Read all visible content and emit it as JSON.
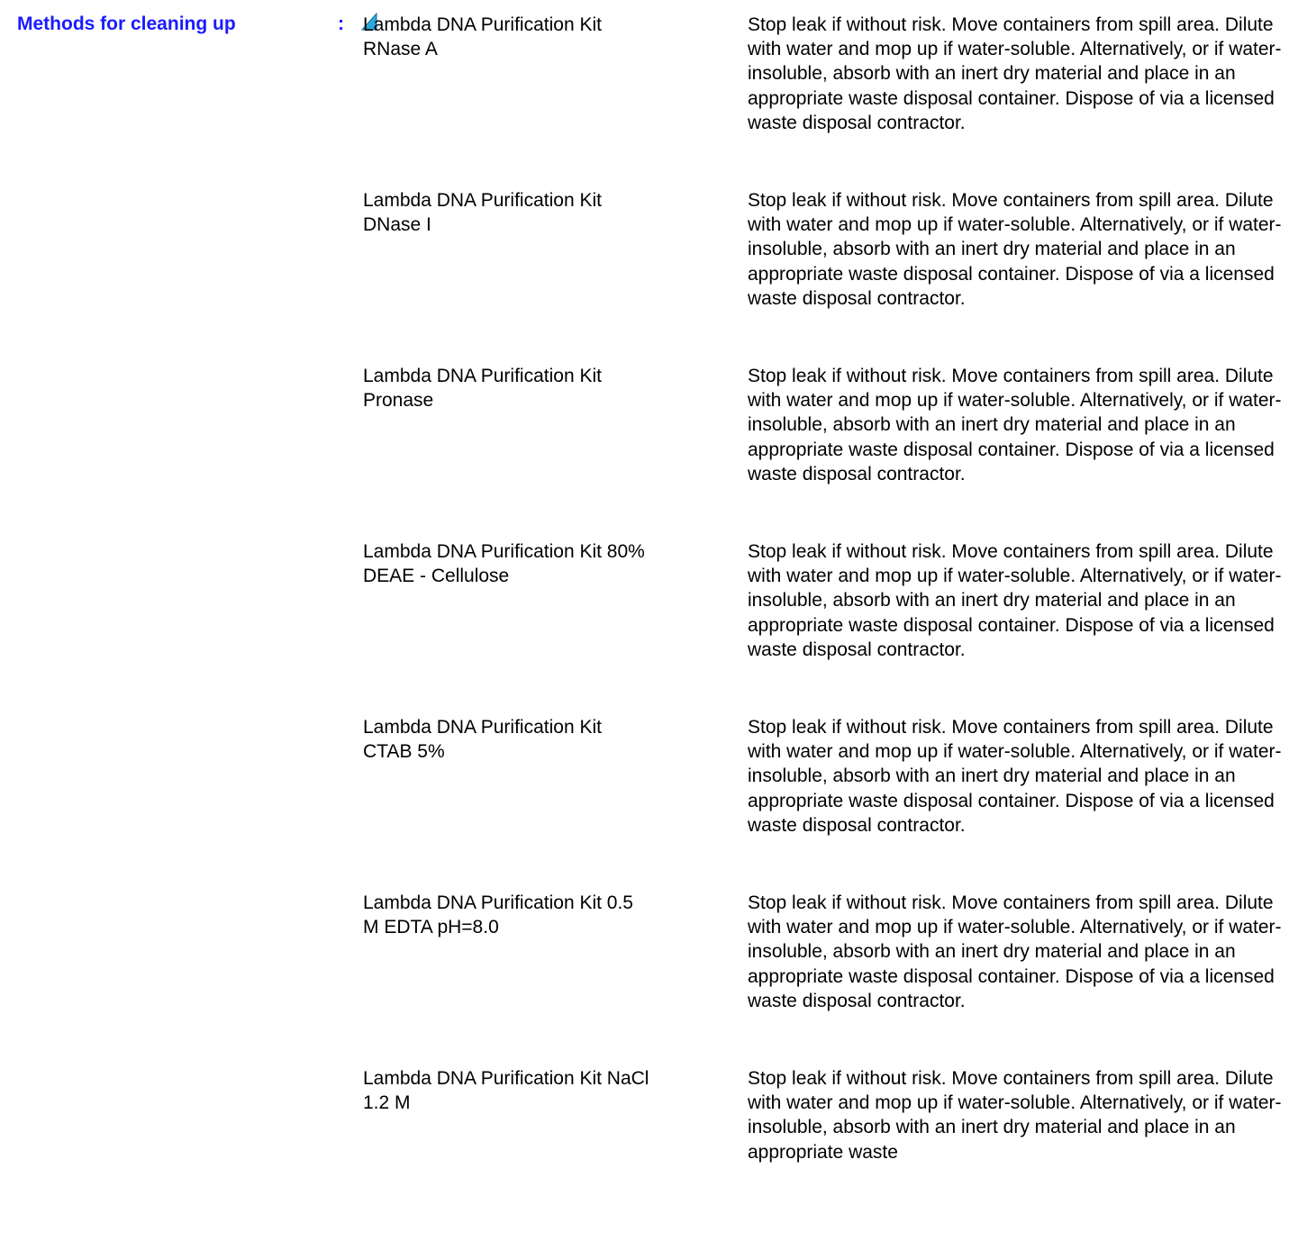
{
  "section": {
    "label": "Methods for cleaning up",
    "colon": ":"
  },
  "colors": {
    "label": "#1a1aff",
    "marker": "#2aa8e0"
  },
  "rows": [
    {
      "product_line1": "Lambda DNA Purification Kit",
      "product_line2": "RNase A",
      "description": "Stop leak if without risk.  Move containers from spill area.  Dilute with water and mop up if water-soluble. Alternatively, or if water-insoluble, absorb with an inert dry material and place in an appropriate waste disposal container.  Dispose of via a licensed waste disposal contractor."
    },
    {
      "product_line1": "Lambda DNA Purification Kit",
      "product_line2": "DNase I",
      "description": "Stop leak if without risk.  Move containers from spill area.  Dilute with water and mop up if water-soluble. Alternatively, or if water-insoluble, absorb with an inert dry material and place in an appropriate waste disposal container.  Dispose of via a licensed waste disposal contractor."
    },
    {
      "product_line1": "Lambda DNA Purification Kit",
      "product_line2": "Pronase",
      "description": "Stop leak if without risk.  Move containers from spill area.  Dilute with water and mop up if water-soluble. Alternatively, or if water-insoluble, absorb with an inert dry material and place in an appropriate waste disposal container.  Dispose of via a licensed waste disposal contractor."
    },
    {
      "product_line1": "Lambda DNA Purification Kit 80%",
      "product_line2": "DEAE - Cellulose",
      "description": "Stop leak if without risk.  Move containers from spill area.  Dilute with water and mop up if water-soluble. Alternatively, or if water-insoluble, absorb with an inert dry material and place in an appropriate waste disposal container.  Dispose of via a licensed waste disposal contractor."
    },
    {
      "product_line1": "Lambda DNA Purification Kit",
      "product_line2": "CTAB 5%",
      "description": "Stop leak if without risk.  Move containers from spill area.  Dilute with water and mop up if water-soluble. Alternatively, or if water-insoluble, absorb with an inert dry material and place in an appropriate waste disposal container.  Dispose of via a licensed waste disposal contractor."
    },
    {
      "product_line1": "Lambda DNA Purification Kit 0.5",
      "product_line2": "M EDTA pH=8.0",
      "description": "Stop leak if without risk.  Move containers from spill area.  Dilute with water and mop up if water-soluble. Alternatively, or if water-insoluble, absorb with an inert dry material and place in an appropriate waste disposal container.  Dispose of via a licensed waste disposal contractor."
    },
    {
      "product_line1": "Lambda DNA Purification Kit NaCl",
      "product_line2": "1.2 M",
      "description": "Stop leak if without risk.  Move containers from spill area.  Dilute with water and mop up if water-soluble. Alternatively, or if water-insoluble, absorb with an inert dry material and place in an appropriate waste"
    }
  ]
}
